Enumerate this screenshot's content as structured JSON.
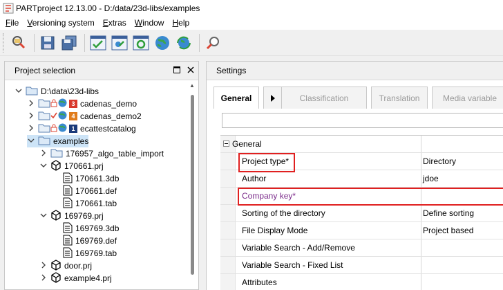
{
  "window": {
    "title": "PARTproject 12.13.00 - D:/data/23d-libs/examples"
  },
  "menu": [
    {
      "label": "File",
      "key": "F",
      "rest": "ile"
    },
    {
      "label": "Versioning system",
      "key": "V",
      "rest": "ersioning system"
    },
    {
      "label": "Extras",
      "key": "E",
      "rest": "xtras"
    },
    {
      "label": "Window",
      "key": "W",
      "rest": "indow"
    },
    {
      "label": "Help",
      "key": "H",
      "rest": "elp"
    }
  ],
  "toolbar": {
    "icons": [
      "search-catalog-icon",
      "save-icon",
      "save-all-icon",
      "check-catalog-icon",
      "check-project-icon",
      "check-all-icon",
      "globe-icon",
      "globe-refresh-icon",
      "search-tool-icon"
    ]
  },
  "project_selection": {
    "title": "Project selection",
    "tree": [
      {
        "label": "D:\\data\\23d-libs",
        "level": 0,
        "chev": "⌄",
        "type": "folder"
      },
      {
        "label": "cadenas_demo",
        "level": 1,
        "chev": "›",
        "type": "catalog",
        "badge": "3",
        "badge_color": "#d9382c",
        "lock": true
      },
      {
        "label": "cadenas_demo2",
        "level": 1,
        "chev": "›",
        "type": "catalog",
        "badge": "4",
        "badge_color": "#e07b1a",
        "check": true
      },
      {
        "label": "ecattestcatalog",
        "level": 1,
        "chev": "›",
        "type": "catalog",
        "badge": "1",
        "badge_color": "#1a3a7a",
        "lock": true
      },
      {
        "label": "examples",
        "level": 1,
        "chev": "⌄",
        "type": "folder",
        "selected": true
      },
      {
        "label": "176957_algo_table_import",
        "level": 2,
        "chev": "›",
        "type": "folder"
      },
      {
        "label": "170661.prj",
        "level": 2,
        "chev": "⌄",
        "type": "cube"
      },
      {
        "label": "170661.3db",
        "level": 3,
        "chev": "",
        "type": "file"
      },
      {
        "label": "170661.def",
        "level": 3,
        "chev": "",
        "type": "file"
      },
      {
        "label": "170661.tab",
        "level": 3,
        "chev": "",
        "type": "file"
      },
      {
        "label": "169769.prj",
        "level": 2,
        "chev": "⌄",
        "type": "cube"
      },
      {
        "label": "169769.3db",
        "level": 3,
        "chev": "",
        "type": "file"
      },
      {
        "label": "169769.def",
        "level": 3,
        "chev": "",
        "type": "file"
      },
      {
        "label": "169769.tab",
        "level": 3,
        "chev": "",
        "type": "file"
      },
      {
        "label": "door.prj",
        "level": 2,
        "chev": "›",
        "type": "cube"
      },
      {
        "label": "example4.prj",
        "level": 2,
        "chev": "›",
        "type": "cube"
      }
    ]
  },
  "settings": {
    "title": "Settings",
    "tabs": [
      {
        "label": "General",
        "active": true
      },
      {
        "label": "Classification",
        "active": false
      },
      {
        "label": "Translation",
        "active": false
      },
      {
        "label": "Media variable",
        "active": false
      }
    ],
    "group_label": "General",
    "rows": [
      {
        "name": "Project type*",
        "value": "Directory",
        "highlight": true
      },
      {
        "name": "Author",
        "value": "jdoe"
      },
      {
        "name": "Company key*",
        "value": "",
        "highlight": true,
        "purple": true
      },
      {
        "name": "Sorting of the directory",
        "value": "Define sorting"
      },
      {
        "name": "File Display Mode",
        "value": "Project based"
      },
      {
        "name": "Variable Search - Add/Remove",
        "value": ""
      },
      {
        "name": "Variable Search - Fixed List",
        "value": ""
      },
      {
        "name": "Attributes",
        "value": ""
      }
    ]
  },
  "colors": {
    "selection": "#cde4f7",
    "highlight_border": "#e02020",
    "required_text": "#7a2a8a"
  }
}
